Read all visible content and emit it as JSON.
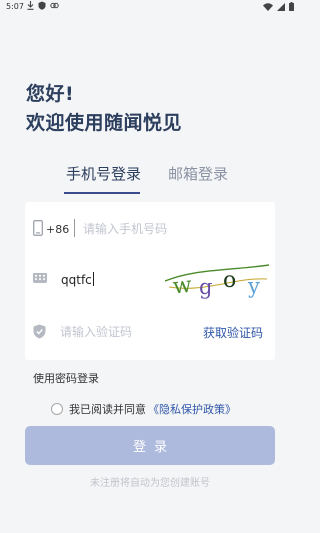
{
  "status_bar": {
    "time": "5:07"
  },
  "greeting": {
    "line1": "您好!",
    "line2": "欢迎使用随闻悦见"
  },
  "tabs": [
    {
      "label": "手机号登录",
      "active": true
    },
    {
      "label": "邮箱登录",
      "active": false
    }
  ],
  "form": {
    "country_code": "+86",
    "phone_placeholder": "请输入手机号码",
    "captcha_value": "qqtfc",
    "captcha_image_text": "wgoy",
    "code_placeholder": "请输入验证码",
    "get_code_label": "获取验证码"
  },
  "password_login_label": "使用密码登录",
  "agreement": {
    "prefix": "我已阅读并同意",
    "policy_link": "《隐私保护政策》"
  },
  "login_button_label": "登录",
  "footer_hint": "未注册将自动为您创建账号",
  "colors": {
    "accent": "#2f57a8",
    "button_disabled": "#aebadd",
    "title": "#2d3f5e",
    "background": "#f4f5f7"
  },
  "icons": [
    "download-icon",
    "play-protect-icon",
    "link-icon",
    "wifi-icon",
    "signal-icon",
    "battery-icon",
    "phone-icon",
    "keyboard-icon",
    "shield-icon"
  ]
}
